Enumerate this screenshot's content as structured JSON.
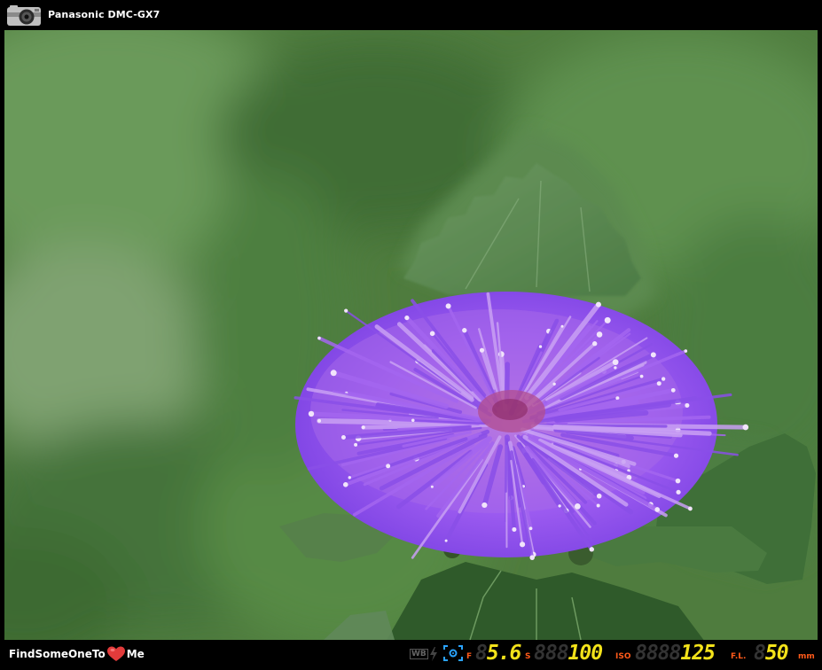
{
  "header": {
    "camera_icon": "camera-icon",
    "camera_model": "Panasonic DMC-GX7"
  },
  "photo": {
    "subject": "purple flower",
    "colors": {
      "background_green": "#4e7a3d",
      "petal_purple": "#9a5cf0",
      "leaf_green": "#3f6a34"
    }
  },
  "footer": {
    "brand_prefix": "FindSomeOneTo",
    "brand_suffix": "Me",
    "heart_icon": "heart-icon",
    "exif": {
      "wb_label": "WB",
      "flash_icon": "flash-icon",
      "metering_icon": "metering-icon",
      "aperture_label": "F",
      "aperture_value": "5.6",
      "aperture_ghost": "8",
      "shutter_label": "S",
      "shutter_value": "100",
      "shutter_ghost": "888",
      "iso_label": "ISO",
      "iso_value": "125",
      "iso_ghost": "8888",
      "focal_label": "F.L.",
      "focal_value": "50",
      "focal_ghost": "8",
      "focal_unit": "mm",
      "accent_color": "#ff5a1a",
      "value_color": "#f3e21a"
    }
  }
}
